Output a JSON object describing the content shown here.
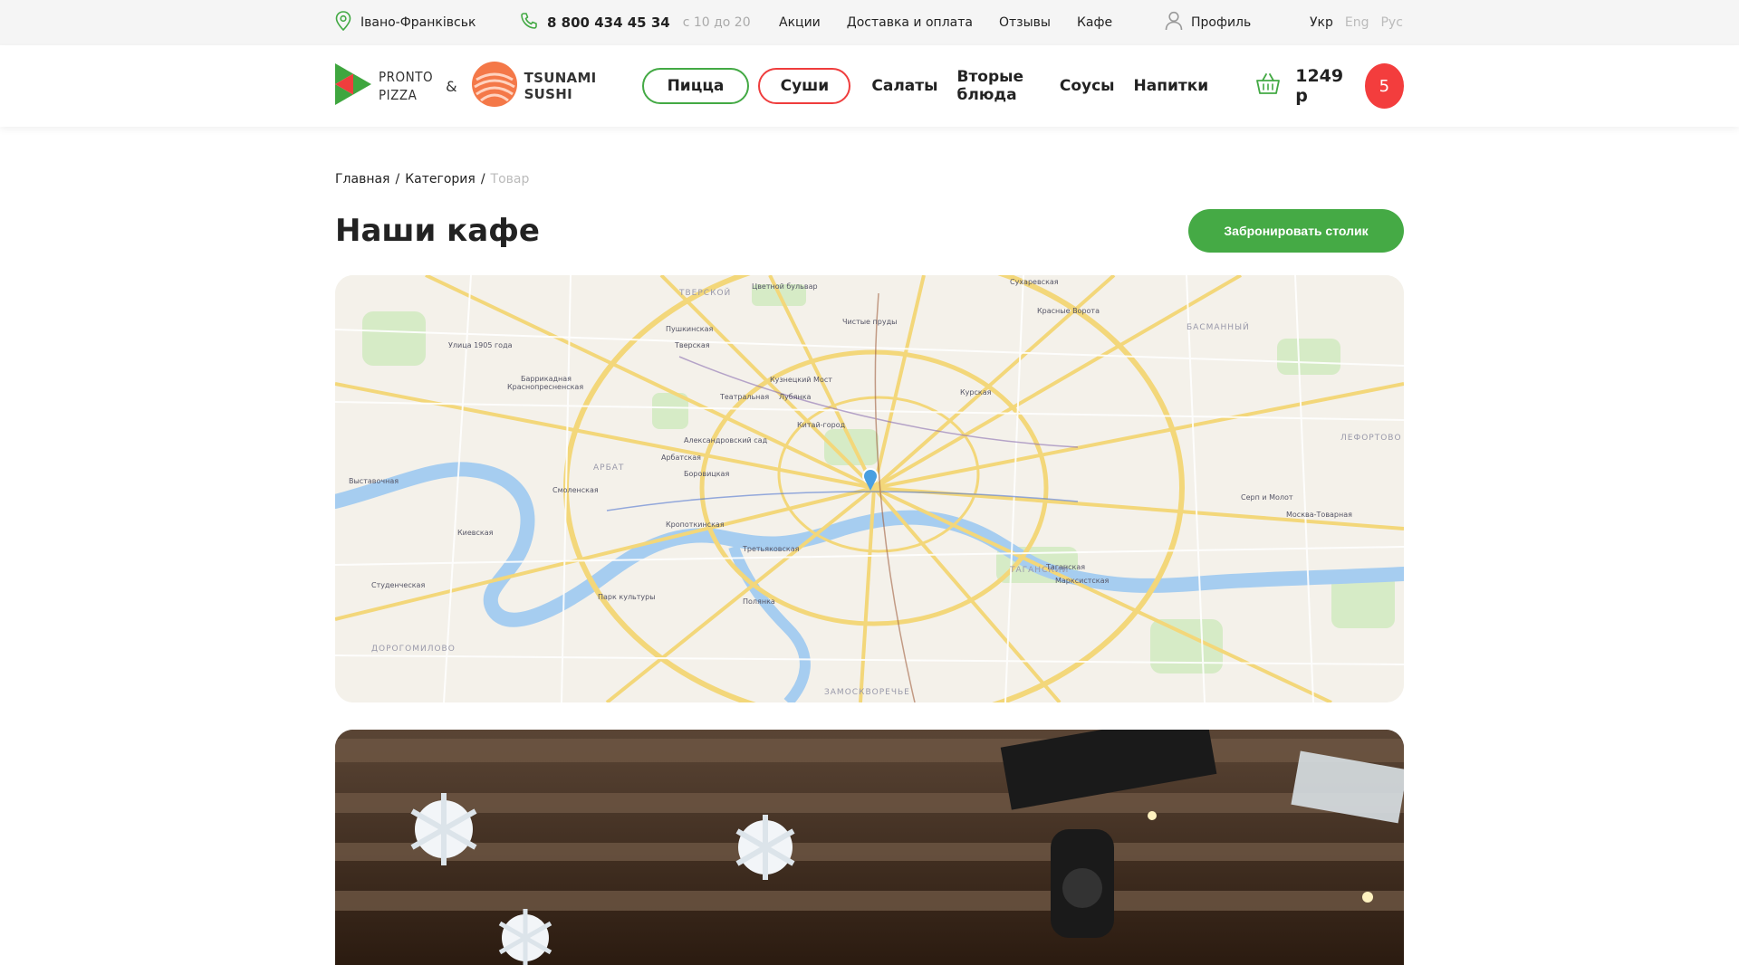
{
  "topbar": {
    "city": "Івано-Франківськ",
    "phone": "8 800 434 45 34",
    "hours": "с 10 до 20",
    "links": [
      "Акции",
      "Доставка и оплата",
      "Отзывы",
      "Кафе"
    ],
    "profile": "Профиль",
    "languages": [
      {
        "label": "Укр",
        "active": true
      },
      {
        "label": "Eng",
        "active": false
      },
      {
        "label": "Рус",
        "active": false
      }
    ]
  },
  "header": {
    "logo_pronto_line1": "PRONTO",
    "logo_pronto_line2": "PIZZA",
    "amp": "&",
    "logo_tsunami_line1": "TSUNAMI",
    "logo_tsunami_line2": "SUSHI",
    "nav": {
      "pizza": "Пицца",
      "sushi": "Суши",
      "salads": "Салаты",
      "mains": "Вторые блюда",
      "sauces": "Соусы",
      "drinks": "Напитки"
    },
    "cart_amount": "1249 р",
    "cart_count": "5"
  },
  "breadcrumb": {
    "home": "Главная",
    "category": "Категория",
    "current": "Товар",
    "sep": "/"
  },
  "page": {
    "title": "Наши кафе",
    "book_button": "Забронировать столик"
  },
  "map": {
    "labels": [
      "ТВЕРСКОЙ",
      "БАСМАННЫЙ",
      "АРБАТ",
      "ЛЕФОРТОВО",
      "ТАГАНСКИЙ",
      "ДОРОГОМИЛОВО",
      "ЗАМОСКВОРЕЧЬЕ",
      "Пушкинская",
      "Кузнецкий Мост",
      "Лубянка",
      "Театральная",
      "Китай-город",
      "Александровский сад",
      "Боровицкая",
      "Кропоткинская",
      "Смоленская",
      "Киевская",
      "Курская",
      "Таганская",
      "Марксистская",
      "Парк культуры",
      "Полянка",
      "Третьяковская",
      "Серп и Молот",
      "Москва-Товарная",
      "Красные Ворота",
      "Сухаревская",
      "Цветной бульвар",
      "Баррикадная",
      "Краснопресненская",
      "Улица 1905 года",
      "Выставочная",
      "Студенческая",
      "Арбатская",
      "Чистые пруды",
      "Тверская"
    ],
    "colors": {
      "water": "#a6cdf0",
      "road": "#f3d77a",
      "park": "#cfe8c0",
      "land": "#f4f1ea",
      "pin": "#4a9fe0"
    }
  },
  "colors": {
    "green": "#43a944",
    "red": "#ef3d3d",
    "badge": "#f33d3d"
  }
}
